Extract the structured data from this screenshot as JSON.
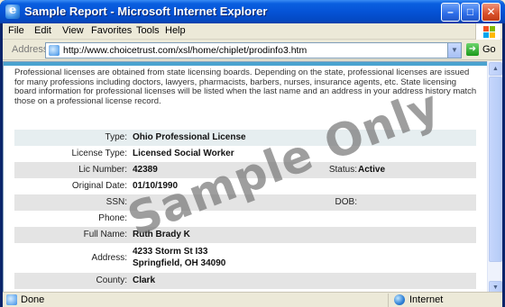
{
  "window": {
    "title": "Sample Report - Microsoft Internet Explorer",
    "minimize": "–",
    "maximize": "□",
    "close": "✕"
  },
  "menu": [
    {
      "label": "File",
      "key": "F"
    },
    {
      "label": "Edit",
      "key": "E"
    },
    {
      "label": "View",
      "key": "V"
    },
    {
      "label": "Favorites",
      "key": "a"
    },
    {
      "label": "Tools",
      "key": "T"
    },
    {
      "label": "Help",
      "key": "H"
    }
  ],
  "address": {
    "label": "Address",
    "url": "http://www.choicetrust.com/xsl/home/chiplet/prodinfo3.htm",
    "go_label": "Go"
  },
  "report": {
    "intro": "Professional licenses are obtained from state licensing boards. Depending on the state, professional licenses are issued for many professions including doctors, lawyers, pharmacists, barbers, nurses, insurance agents, etc. State licensing board information for professional licenses will be listed when the last name and an address in your address history match those on a professional license record.",
    "type_label": "Type:",
    "type_value": "Ohio Professional License",
    "license_type_label": "License Type:",
    "license_type_value": "Licensed Social Worker",
    "lic_number_label": "Lic Number:",
    "lic_number_value": "42389",
    "status_label": "Status:",
    "status_value": "Active",
    "original_date_label": "Original Date:",
    "original_date_value": "01/10/1990",
    "ssn_label": "SSN:",
    "ssn_value": "",
    "dob_label": "DOB:",
    "dob_value": "",
    "phone_label": "Phone:",
    "phone_value": "",
    "full_name_label": "Full Name:",
    "full_name_value": "Ruth Brady K",
    "address_label": "Address:",
    "address_line1": "4233 Storm St I33",
    "address_line2": "Springfield, OH 34090",
    "county_label": "County:",
    "county_value": "Clark"
  },
  "watermark": "Sample Only",
  "status": {
    "text": "Done",
    "zone": "Internet"
  }
}
